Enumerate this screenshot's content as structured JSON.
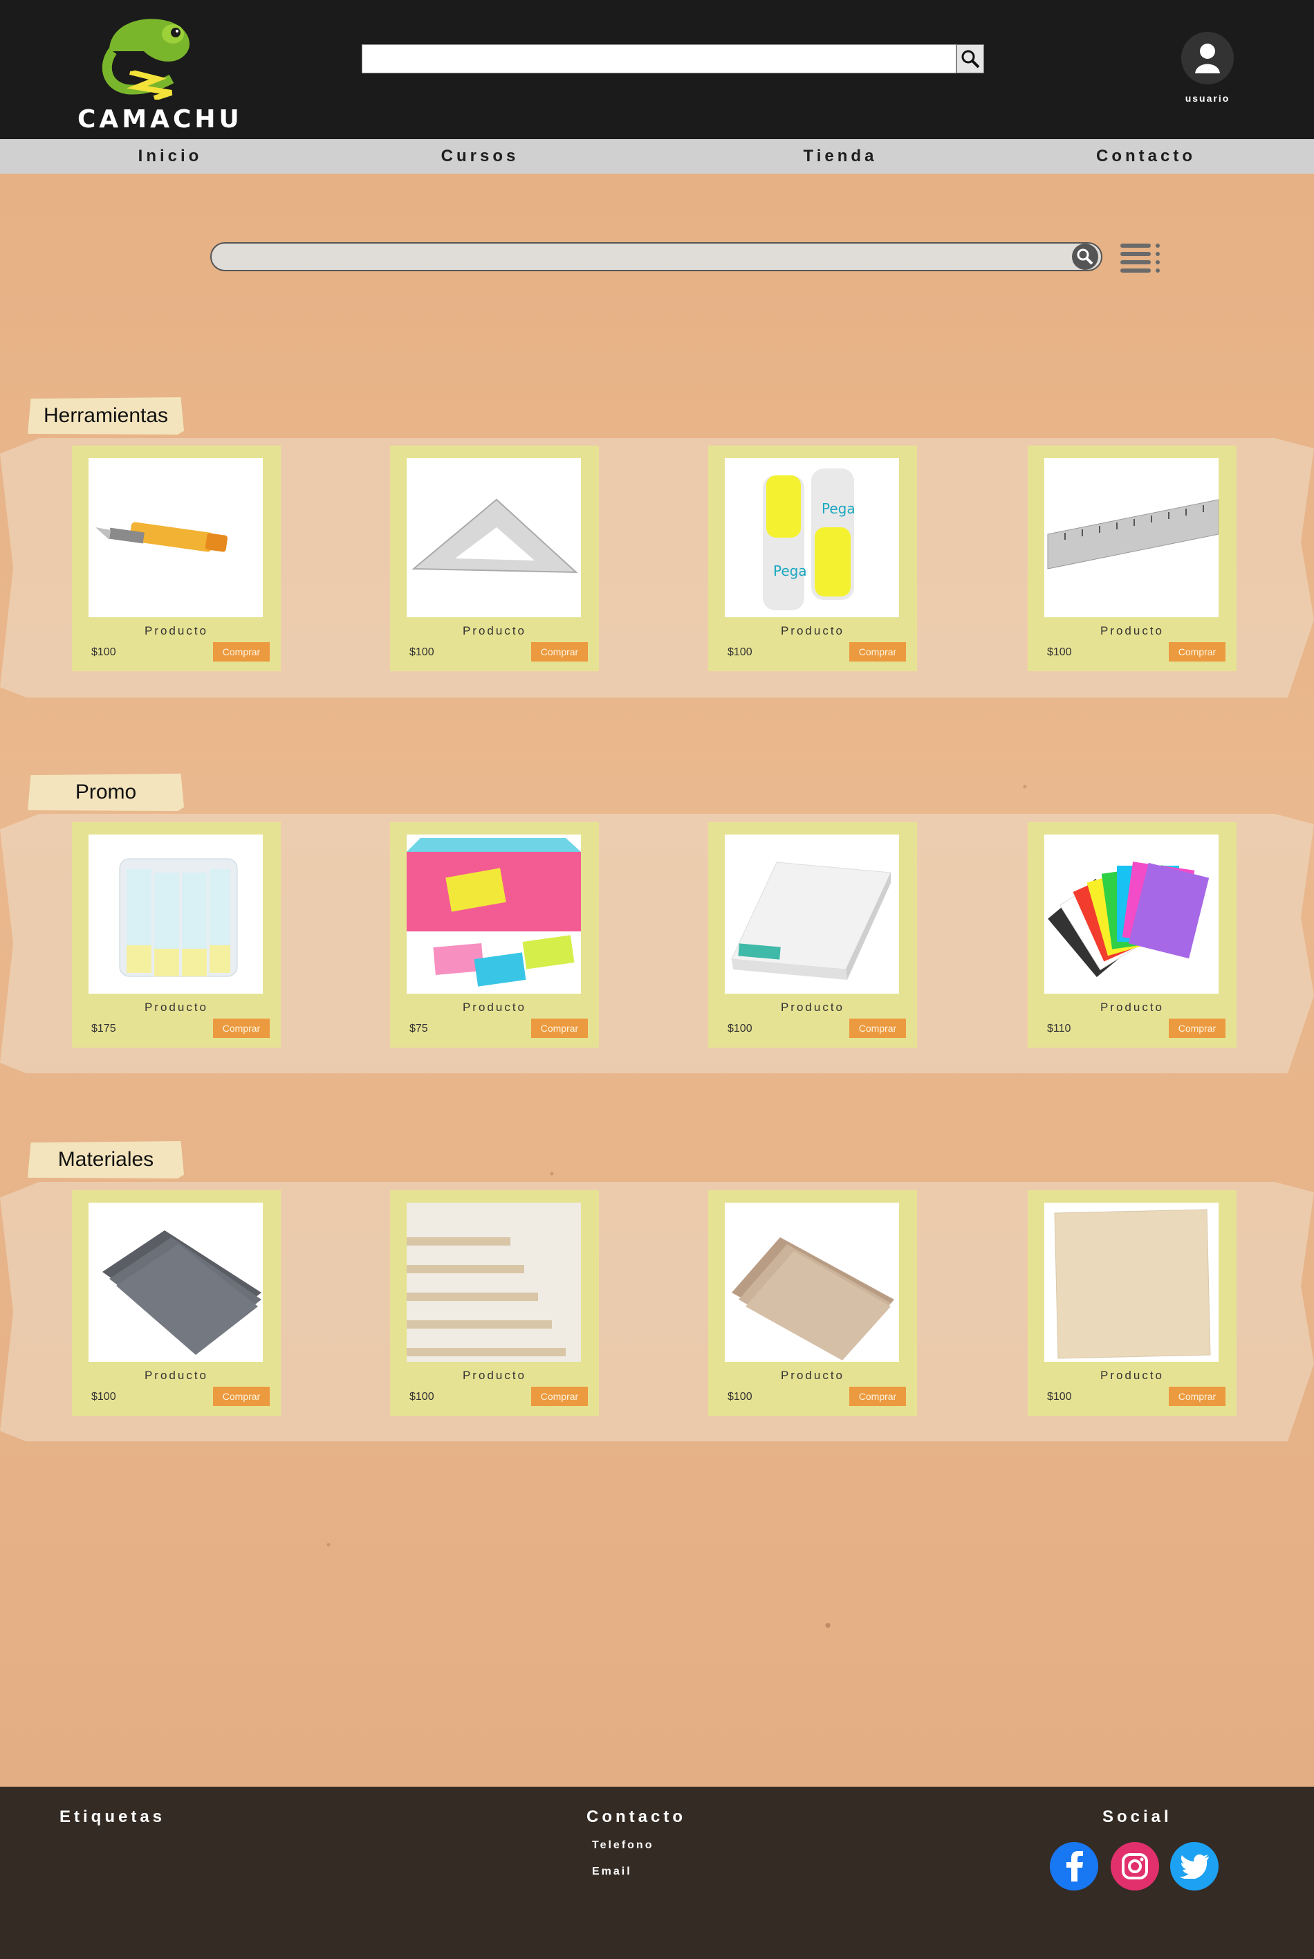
{
  "brand": {
    "name": "CAMACHU"
  },
  "header": {
    "search_value": "",
    "user_label": "usuario"
  },
  "nav": {
    "items": [
      "Inicio",
      "Cursos",
      "Tienda",
      "Contacto"
    ]
  },
  "catalog_search": {
    "value": ""
  },
  "sections": [
    {
      "title": "Herramientas",
      "products": [
        {
          "name": "Producto",
          "price": "$100",
          "buy": "Comprar",
          "image": "cutter-knife"
        },
        {
          "name": "Producto",
          "price": "$100",
          "buy": "Comprar",
          "image": "set-square"
        },
        {
          "name": "Producto",
          "price": "$100",
          "buy": "Comprar",
          "image": "glue-sticks"
        },
        {
          "name": "Producto",
          "price": "$100",
          "buy": "Comprar",
          "image": "metal-ruler"
        }
      ]
    },
    {
      "title": "Promo",
      "products": [
        {
          "name": "Producto",
          "price": "$175",
          "buy": "Comprar",
          "image": "glue-stick-pack"
        },
        {
          "name": "Producto",
          "price": "$75",
          "buy": "Comprar",
          "image": "sticky-notes"
        },
        {
          "name": "Producto",
          "price": "$100",
          "buy": "Comprar",
          "image": "paper-ream"
        },
        {
          "name": "Producto",
          "price": "$110",
          "buy": "Comprar",
          "image": "color-sheets"
        }
      ]
    },
    {
      "title": "Materiales",
      "products": [
        {
          "name": "Producto",
          "price": "$100",
          "buy": "Comprar",
          "image": "gray-board"
        },
        {
          "name": "Producto",
          "price": "$100",
          "buy": "Comprar",
          "image": "mdf-boards"
        },
        {
          "name": "Producto",
          "price": "$100",
          "buy": "Comprar",
          "image": "cardboard-sheets"
        },
        {
          "name": "Producto",
          "price": "$100",
          "buy": "Comprar",
          "image": "kraft-sheet"
        }
      ]
    }
  ],
  "footer": {
    "tags_title": "Etiquetas",
    "contact_title": "Contacto",
    "phone_label": "Telefono",
    "email_label": "Email",
    "social_title": "Social"
  },
  "colors": {
    "header_bg": "#1b1b1b",
    "nav_bg": "#d0d0d0",
    "card_bg": "#e6e293",
    "buy_button": "#ec9a3f",
    "footer_bg": "#342b24",
    "facebook": "#1877f2",
    "instagram": "#e1306c",
    "twitter": "#1da1f2"
  }
}
